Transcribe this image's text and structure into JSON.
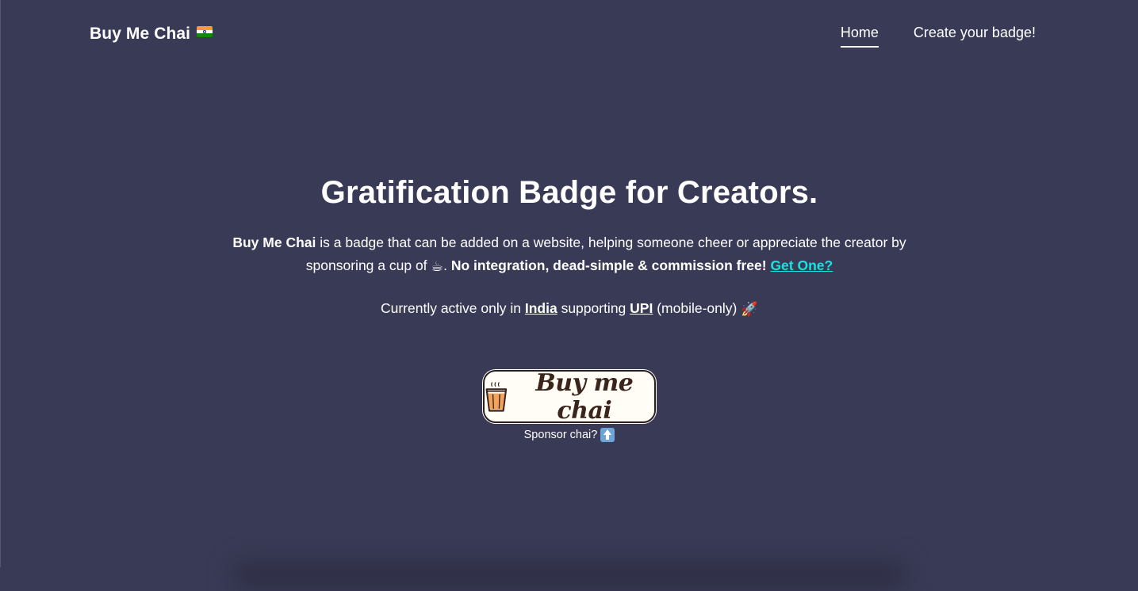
{
  "nav": {
    "brand": "Buy Me Chai",
    "brand_flag_icon": "india-flag-icon",
    "links": [
      {
        "label": "Home",
        "active": true
      },
      {
        "label": "Create your badge!",
        "active": false
      }
    ]
  },
  "hero": {
    "title": "Gratification Badge for Creators.",
    "desc_brand": "Buy Me Chai",
    "desc_part1": " is a badge that can be added on a website, helping someone cheer or appreciate the creator by sponsoring a cup of ",
    "desc_cup_emoji": "☕",
    "desc_part2": ". ",
    "desc_bold": "No integration, dead-simple & commission free!",
    "desc_space": " ",
    "get_one": "Get One?",
    "sub_part1": "Currently active only in ",
    "sub_india": "India",
    "sub_part2": " supporting ",
    "sub_upi": "UPI",
    "sub_part3": " (mobile-only) ",
    "sub_rocket_emoji": "🚀"
  },
  "badge": {
    "label": "Buy me chai",
    "icon": "chai-glass-icon",
    "caption": "Sponsor chai?",
    "caption_icon": "up-arrow-icon"
  },
  "colors": {
    "background": "#393a55",
    "link_accent": "#17e3e3",
    "badge_bg": "#fffdf6",
    "badge_text": "#3a241c"
  }
}
